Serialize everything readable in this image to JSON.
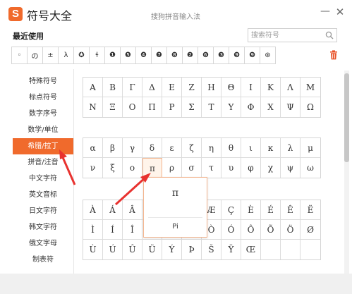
{
  "app": {
    "logo_char": "S",
    "title": "符号大全",
    "ime_title": "搜狗拼音输入法",
    "minimize_glyph": "—",
    "close_glyph": "✕"
  },
  "recent": {
    "label": "最近使用",
    "search_placeholder": "搜索符号",
    "cells": [
      "◦",
      "の",
      "±",
      "λ",
      "✪",
      "ɬ",
      "❶",
      "❺",
      "❹",
      "❼",
      "❽",
      "❷",
      "❻",
      "❸",
      "❾",
      "❾",
      "⊛"
    ]
  },
  "sidebar": {
    "items": [
      {
        "label": "特殊符号",
        "active": false
      },
      {
        "label": "标点符号",
        "active": false
      },
      {
        "label": "数字序号",
        "active": false
      },
      {
        "label": "数学/单位",
        "active": false
      },
      {
        "label": "希腊/拉丁",
        "active": true
      },
      {
        "label": "拼音/注音",
        "active": false
      },
      {
        "label": "中文字符",
        "active": false
      },
      {
        "label": "英文音标",
        "active": false
      },
      {
        "label": "日文字符",
        "active": false
      },
      {
        "label": "韩文字符",
        "active": false
      },
      {
        "label": "俄文字母",
        "active": false
      },
      {
        "label": "制表符",
        "active": false
      }
    ]
  },
  "greek_upper": [
    [
      "Α",
      "Β",
      "Γ",
      "Δ",
      "Ε",
      "Ζ",
      "Η",
      "Θ",
      "Ι",
      "Κ",
      "Λ",
      "Μ"
    ],
    [
      "Ν",
      "Ξ",
      "Ο",
      "Π",
      "Ρ",
      "Σ",
      "Τ",
      "Υ",
      "Φ",
      "Χ",
      "Ψ",
      "Ω"
    ]
  ],
  "greek_lower": [
    [
      "α",
      "β",
      "γ",
      "δ",
      "ε",
      "ζ",
      "η",
      "θ",
      "ι",
      "κ",
      "λ",
      "μ"
    ],
    [
      "ν",
      "ξ",
      "ο",
      "π",
      "ρ",
      "σ",
      "τ",
      "υ",
      "φ",
      "χ",
      "ψ",
      "ω"
    ]
  ],
  "latin": [
    [
      "À",
      "Á",
      "Â",
      "",
      "",
      "",
      "Æ",
      "Ç",
      "È",
      "É",
      "Ê",
      "Ë"
    ],
    [
      "Ì",
      "Í",
      "Î",
      "",
      "",
      "",
      "Ò",
      "Ó",
      "Ô",
      "Õ",
      "Ö",
      "Ø"
    ],
    [
      "Ù",
      "Ú",
      "Û",
      "Ü",
      "Ý",
      "Þ",
      "Š",
      "Ÿ",
      "Œ",
      "",
      "",
      ""
    ]
  ],
  "popup": {
    "char": "π",
    "name": "Pi"
  },
  "colors": {
    "accent": "#f06a2c",
    "arrow": "#e8322f"
  }
}
